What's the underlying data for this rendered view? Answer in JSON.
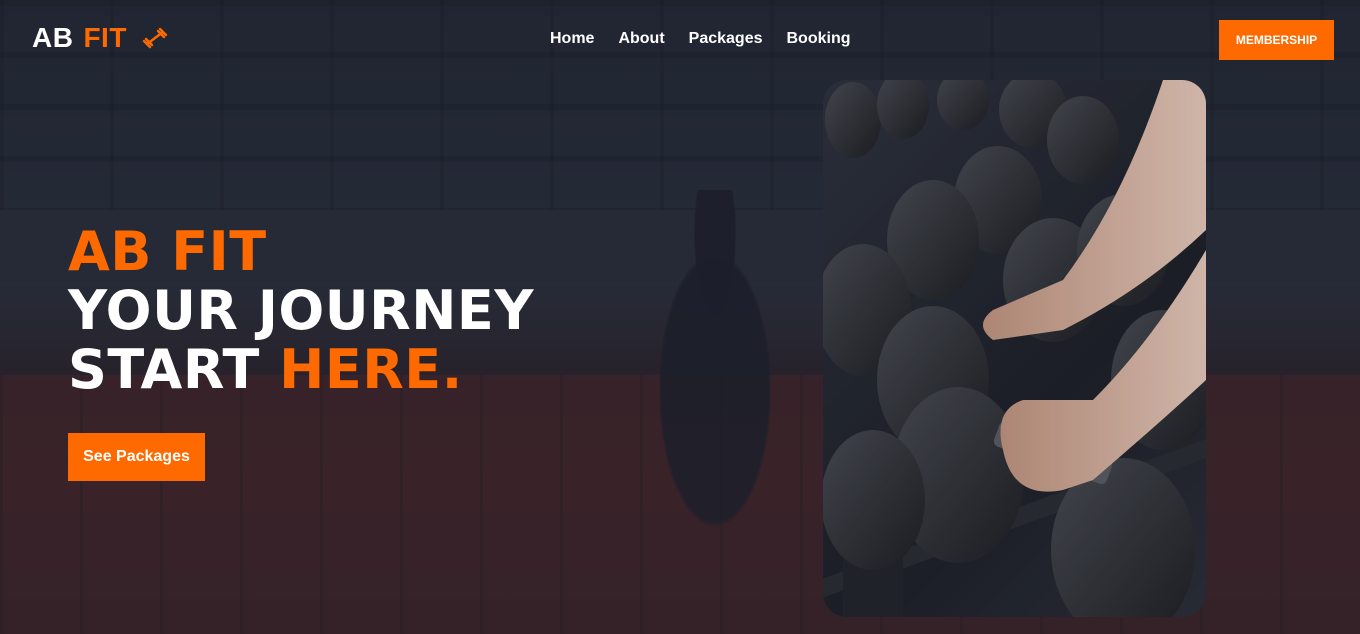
{
  "brand": {
    "part1": "AB",
    "part2": "FIT",
    "icon": "dumbbell-icon",
    "accent_color": "#ff6a00"
  },
  "nav": {
    "items": [
      {
        "label": "Home"
      },
      {
        "label": "About"
      },
      {
        "label": "Packages"
      },
      {
        "label": "Booking"
      }
    ]
  },
  "header": {
    "membership_label": "MEMBERSHIP"
  },
  "hero": {
    "line1": "AB FIT",
    "line2": "YOUR JOURNEY",
    "line3_white": "START",
    "line3_orange": "HERE.",
    "cta_label": "See Packages"
  }
}
